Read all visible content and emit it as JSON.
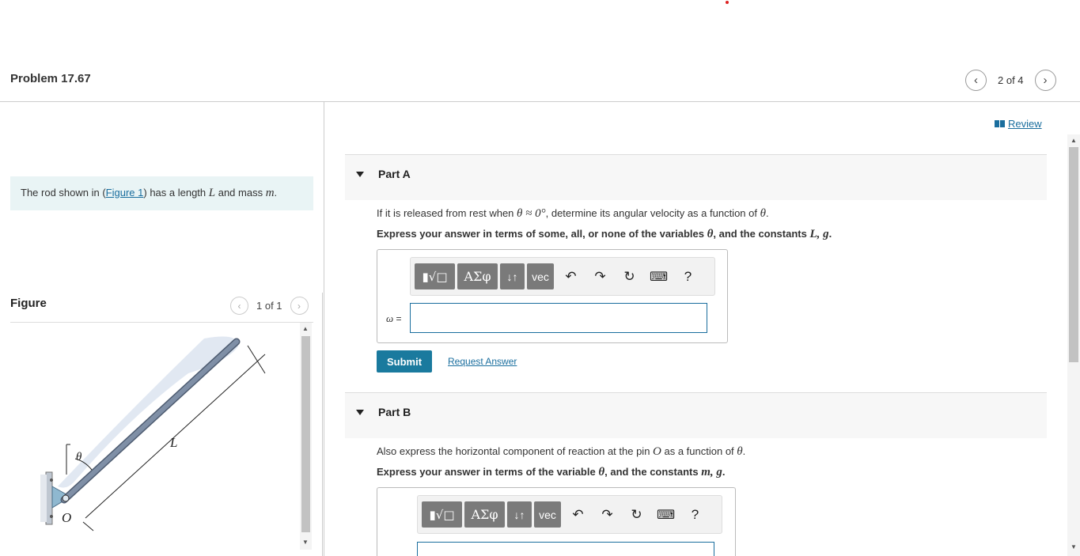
{
  "header": {
    "problem_title": "Problem 17.67",
    "pager_count": "2 of 4",
    "prev_icon": "chevron-left-icon",
    "next_icon": "chevron-right-icon"
  },
  "description": {
    "prefix": "The rod shown in (",
    "figure_link": "Figure 1",
    "middle": ") has a length ",
    "var_L": "L",
    "and_mass": " and mass ",
    "var_m": "m",
    "suffix": "."
  },
  "figure": {
    "label": "Figure",
    "pager_count": "1 of 1",
    "theta_label": "θ",
    "length_label": "L",
    "pin_label": "O"
  },
  "review": {
    "label": "Review",
    "icon": "book-icon"
  },
  "part_a": {
    "label": "Part A",
    "question_prefix": "If it is released from rest when ",
    "question_math": "θ ≈ 0°",
    "question_suffix": ", determine its angular velocity as a function of ",
    "question_var": "θ",
    "question_end": ".",
    "instruction_prefix": "Express your answer in terms of some, all, or none of the variables ",
    "instruction_vars": "θ",
    "instruction_mid": ", and the constants ",
    "instruction_consts": "L, g",
    "instruction_end": ".",
    "eq_var": "ω",
    "eq_sign": " =",
    "submit_label": "Submit",
    "request_label": "Request Answer"
  },
  "part_b": {
    "label": "Part B",
    "question_prefix": "Also express the horizontal component of reaction at the pin ",
    "question_pin": "O",
    "question_suffix": " as a function of ",
    "question_var": "θ",
    "question_end": ".",
    "instruction_prefix": "Express your answer in terms of the variable ",
    "instruction_vars": "θ",
    "instruction_mid": ", and the constants ",
    "instruction_consts": "m, g",
    "instruction_end": "."
  },
  "toolbar": {
    "templates_label": "▮√□",
    "greek_label": "ΑΣφ",
    "arrows_label": "↓↑",
    "vec_label": "vec",
    "undo_icon": "undo-icon",
    "redo_icon": "redo-icon",
    "reset_icon": "reset-icon",
    "keyboard_icon": "keyboard-icon",
    "help_label": "?"
  },
  "colors": {
    "accent": "#1a6e9e",
    "submit_bg": "#1a7a9e",
    "description_bg": "#e9f4f5",
    "toolbar_button": "#7a7a7a"
  }
}
